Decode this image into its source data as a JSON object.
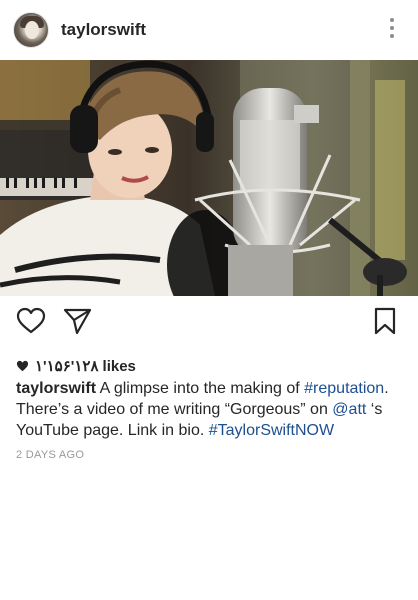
{
  "header": {
    "username": "taylorswift",
    "avatar_icon": "profile-avatar",
    "more_icon": "more-vertical-icon"
  },
  "photo": {
    "alt_icon": "post-photo"
  },
  "actions": {
    "like_icon": "heart-outline-icon",
    "share_icon": "paper-plane-icon",
    "save_icon": "bookmark-icon"
  },
  "likes": {
    "count": "۱'۱۵۶'۱۲۸",
    "label": "likes"
  },
  "caption": {
    "username": "taylorswift",
    "text_1": " A glimpse into the making of ",
    "hashtag_1": "#reputation",
    "text_2": ". There’s a video of me writing “Gorgeous” on ",
    "mention": "@att",
    "text_3": " ‘s YouTube page. Link in bio. ",
    "hashtag_2": "#TaylorSwiftNOW"
  },
  "timestamp": "2 DAYS AGO",
  "colors": {
    "text": "#262626",
    "link": "#1d4f91",
    "muted": "#999999"
  }
}
